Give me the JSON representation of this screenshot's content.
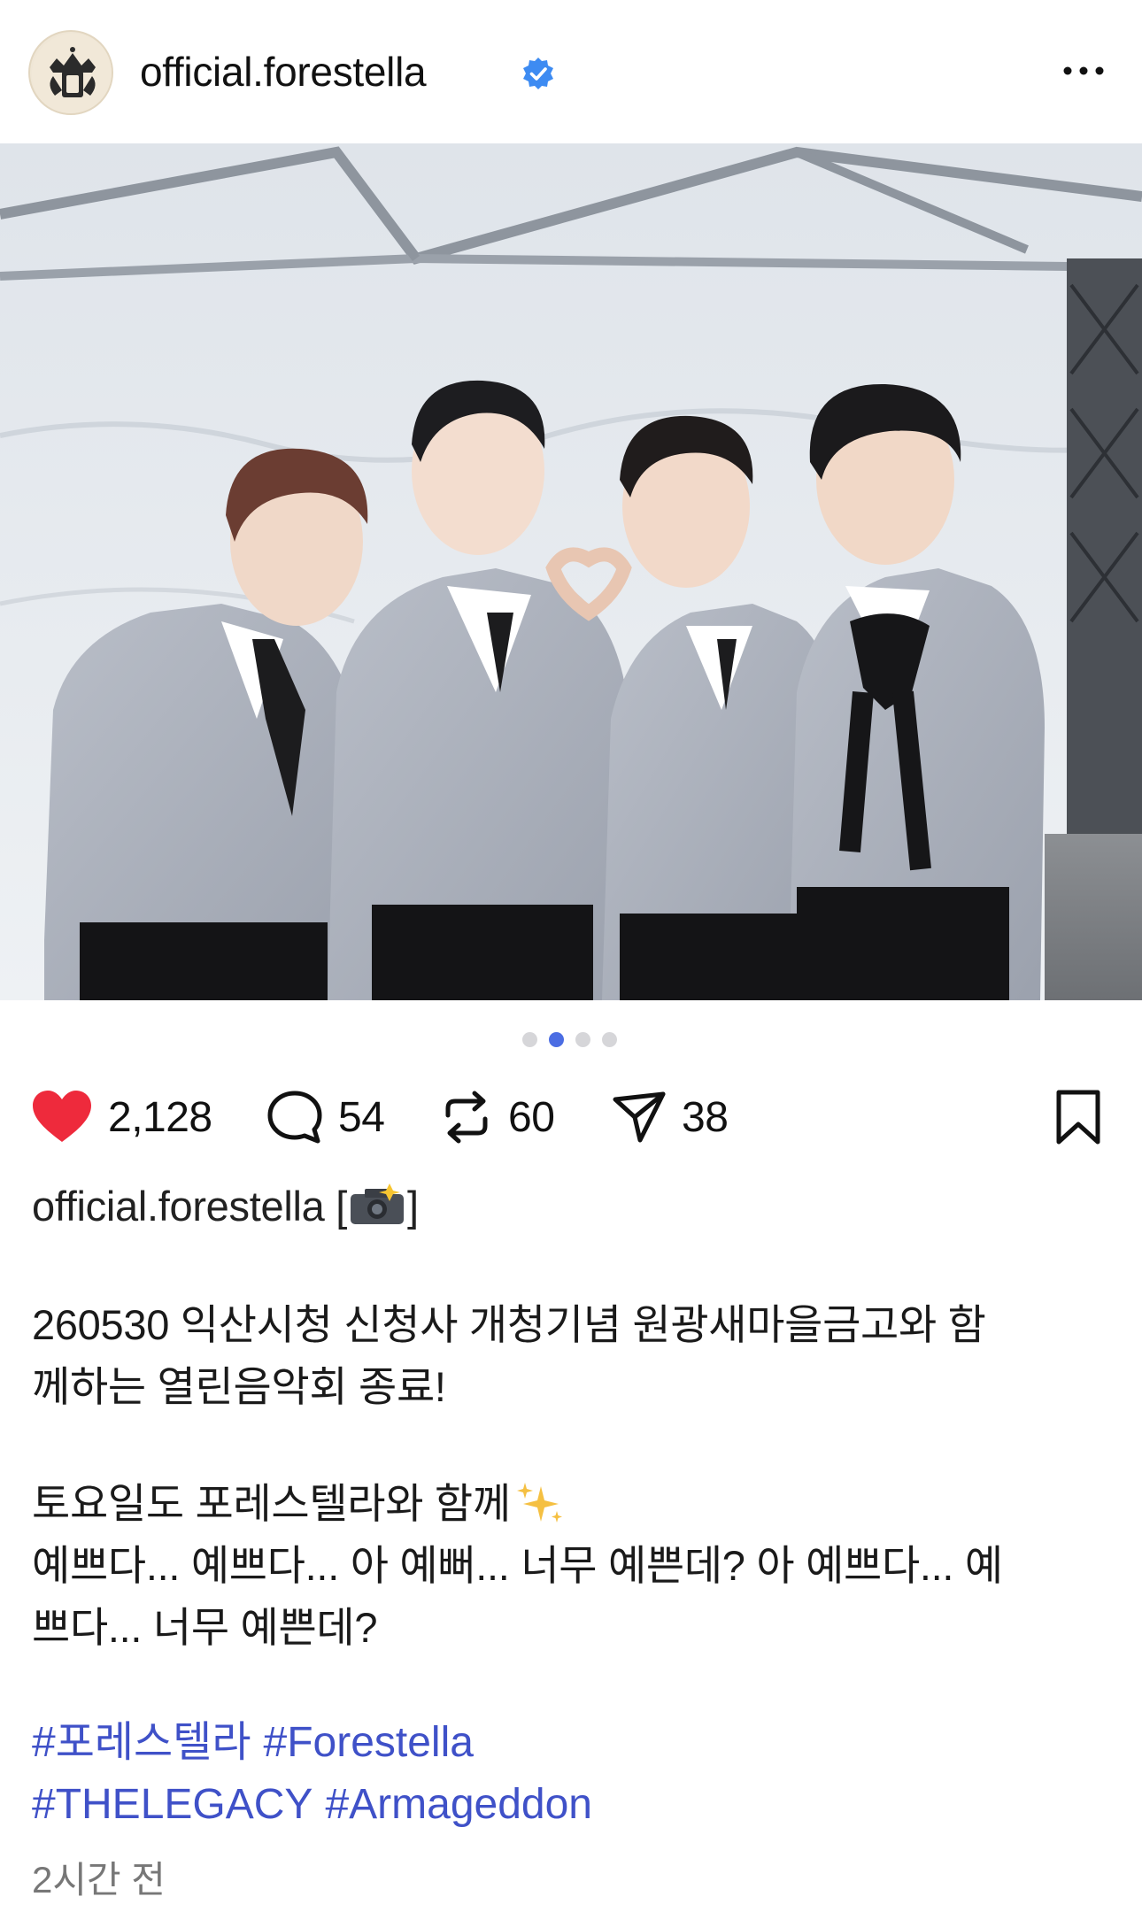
{
  "header": {
    "username": "official.forestella",
    "verified_icon": "verified-badge-icon",
    "more_icon": "more-horizontal-icon"
  },
  "carousel": {
    "dot_count": 4,
    "active_index": 1
  },
  "actions": {
    "like_count": "2,128",
    "comment_count": "54",
    "repost_count": "60",
    "share_count": "38",
    "icons": {
      "like": "heart-icon",
      "comment": "comment-icon",
      "repost": "repost-icon",
      "share": "share-icon",
      "save": "bookmark-icon"
    },
    "like_color": "#ee2a3c"
  },
  "caption": {
    "username": "official.forestella",
    "open_bracket": "[",
    "close_bracket": "]",
    "line1": "260530 익산시청 신청사 개청기념 원광새마을금고와 함",
    "line2": "께하는 열린음악회 종료!",
    "line3": "토요일도 포레스텔라와 함께",
    "line4": "예쁘다... 예쁘다... 아 예뻐... 너무 예쁜데? 아 예쁘다... 예",
    "line5": "쁘다... 너무 예쁜데?",
    "hashtags_row1": [
      "#포레스텔라",
      "#Forestella"
    ],
    "hashtags_row2": [
      "#THELEGACY",
      "#Armageddon"
    ]
  },
  "timestamp": "2시간 전",
  "colors": {
    "hashtag": "#3f51c8",
    "verified": "#3d8bf2",
    "active_dot": "#4b6de3"
  }
}
